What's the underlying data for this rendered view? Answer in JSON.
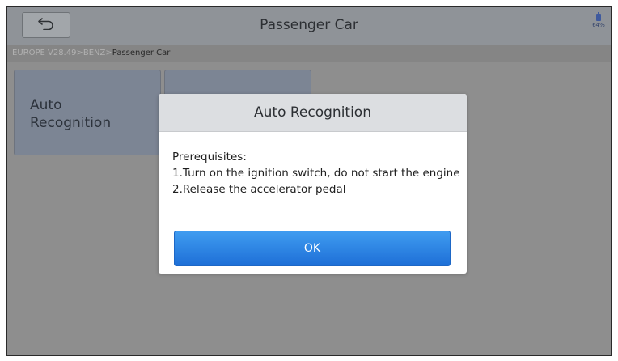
{
  "header": {
    "title": "Passenger Car",
    "back_icon": "back-arrow-icon",
    "battery": {
      "icon": "battery-icon",
      "level_text": "64%"
    }
  },
  "breadcrumb": {
    "parts": [
      "EUROPE V28.49>",
      "BENZ>",
      "Passenger Car"
    ]
  },
  "tiles": [
    {
      "label": "Auto Recognition"
    },
    {
      "label": ""
    }
  ],
  "dialog": {
    "title": "Auto Recognition",
    "lines": [
      "Prerequisites:",
      "1.Turn on the ignition switch, do not start the engine",
      "2.Release the accelerator pedal"
    ],
    "ok_label": "OK"
  },
  "colors": {
    "accent_button": "#1e6fd7",
    "overlay_dim": "#8e8e8e"
  }
}
